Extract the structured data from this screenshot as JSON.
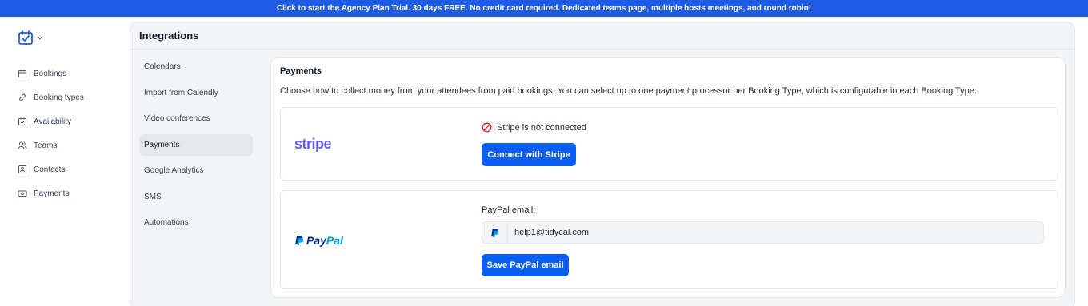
{
  "banner": {
    "text": "Click to start the Agency Plan Trial. 30 days FREE. No credit card required. Dedicated teams page, multiple hosts meetings, and round robin!"
  },
  "colors": {
    "banner": "#1f5ce6",
    "primary_button": "#0a5ef0",
    "stripe": "#635bff",
    "paypal_dark": "#003087",
    "paypal_light": "#009cde",
    "error": "#dc2626"
  },
  "sidebar": {
    "items": [
      {
        "label": "Bookings",
        "icon": "calendar-icon"
      },
      {
        "label": "Booking types",
        "icon": "link-icon"
      },
      {
        "label": "Availability",
        "icon": "calendar-check-icon"
      },
      {
        "label": "Teams",
        "icon": "users-icon"
      },
      {
        "label": "Contacts",
        "icon": "contact-card-icon"
      },
      {
        "label": "Payments",
        "icon": "money-icon"
      }
    ]
  },
  "integrations": {
    "title": "Integrations",
    "subnav": [
      {
        "label": "Calendars"
      },
      {
        "label": "Import from Calendly"
      },
      {
        "label": "Video conferences"
      },
      {
        "label": "Payments",
        "active": true
      },
      {
        "label": "Google Analytics"
      },
      {
        "label": "SMS"
      },
      {
        "label": "Automations"
      }
    ]
  },
  "payments": {
    "title": "Payments",
    "description": "Choose how to collect money from your attendees from paid bookings. You can select up to one payment processor per Booking Type, which is configurable in each Booking Type.",
    "stripe": {
      "logo_text": "stripe",
      "status": "Stripe is not connected",
      "connect_label": "Connect with Stripe"
    },
    "paypal": {
      "logo_pay": "Pay",
      "logo_pal": "Pal",
      "email_label": "PayPal email:",
      "email_value": "help1@tidycal.com",
      "save_label": "Save PayPal email"
    }
  }
}
